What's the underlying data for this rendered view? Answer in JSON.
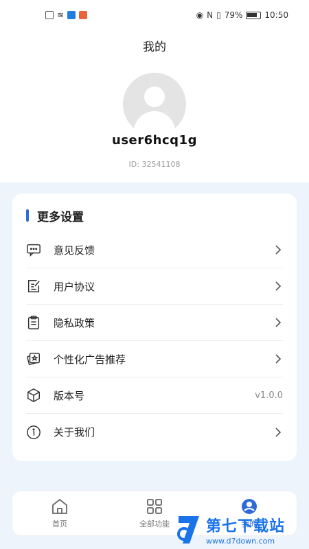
{
  "status_bar": {
    "battery_percent": "79%",
    "time": "10:50"
  },
  "header": {
    "title": "我的"
  },
  "profile": {
    "username": "user6hcq1g",
    "id_text": "ID: 32541108"
  },
  "settings": {
    "section_title": "更多设置",
    "items": [
      {
        "label": "意见反馈",
        "icon": "feedback-icon",
        "trailing": "chevron"
      },
      {
        "label": "用户协议",
        "icon": "agreement-icon",
        "trailing": "chevron"
      },
      {
        "label": "隐私政策",
        "icon": "privacy-icon",
        "trailing": "chevron"
      },
      {
        "label": "个性化广告推荐",
        "icon": "ad-recommend-icon",
        "trailing": "chevron"
      },
      {
        "label": "版本号",
        "icon": "cube-icon",
        "trailing": "v1.0.0"
      },
      {
        "label": "关于我们",
        "icon": "info-icon",
        "trailing": "chevron"
      }
    ]
  },
  "tabbar": {
    "tabs": [
      {
        "label": "首页",
        "icon": "home-icon",
        "active": false
      },
      {
        "label": "全部功能",
        "icon": "grid-icon",
        "active": false
      },
      {
        "label": "我的",
        "icon": "profile-icon",
        "active": true
      }
    ]
  },
  "watermark": {
    "title": "第七下载站",
    "url": "www.d7down.com"
  },
  "colors": {
    "accent": "#2f6bd8",
    "panel_bg": "#eef4fb"
  }
}
